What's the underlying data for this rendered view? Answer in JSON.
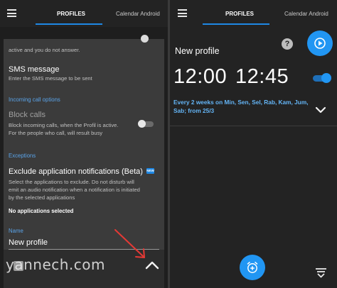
{
  "left": {
    "tabs": [
      {
        "label": "PROFILES",
        "active": true
      },
      {
        "label": "Calendar Android",
        "active": false
      }
    ],
    "cut_text": "active and you do not answer.",
    "sms": {
      "title": "SMS message",
      "desc": "Enter the SMS message to be sent"
    },
    "incoming_section": "Incoming call options",
    "block_calls": {
      "title": "Block calls",
      "desc_line1": "Block incoming calls, when the Profil is active.",
      "desc_line2": "For the people who call, will result busy",
      "enabled": false
    },
    "exceptions_section": "Exceptions",
    "exclude": {
      "title": "Exclude application notifications (Beta)",
      "badge": "NEW",
      "desc_line1": "Select the applications to exclude. Do not disturb will",
      "desc_line2": "emit an audio notification when a notification is initiated",
      "desc_line3": "by the selected applications"
    },
    "no_apps": "No applications selected",
    "name_label": "Name",
    "name_value": "New profile",
    "chevron_icon": "chevron-up-icon"
  },
  "right": {
    "tabs": [
      {
        "label": "PROFILES",
        "active": true
      },
      {
        "label": "Calendar Android",
        "active": false
      }
    ],
    "profile_name": "New profile",
    "help_symbol": "?",
    "start_time": "12:00",
    "end_time": "12:45",
    "toggle_on": true,
    "schedule_text": "Every 2 weeks on Min, Sen, Sel, Rab, Kam, Jum, Sab; from 25/3",
    "expand_icon": "chevron-down-icon",
    "fab_icon": "add-alarm-icon",
    "filter_icon": "sort-icon"
  },
  "watermark": "yannech.com",
  "colors": {
    "accent": "#2196f3",
    "section_blue": "#5aa3e8",
    "schedule_blue": "#64b5f6",
    "arrow_red": "#e53935"
  }
}
